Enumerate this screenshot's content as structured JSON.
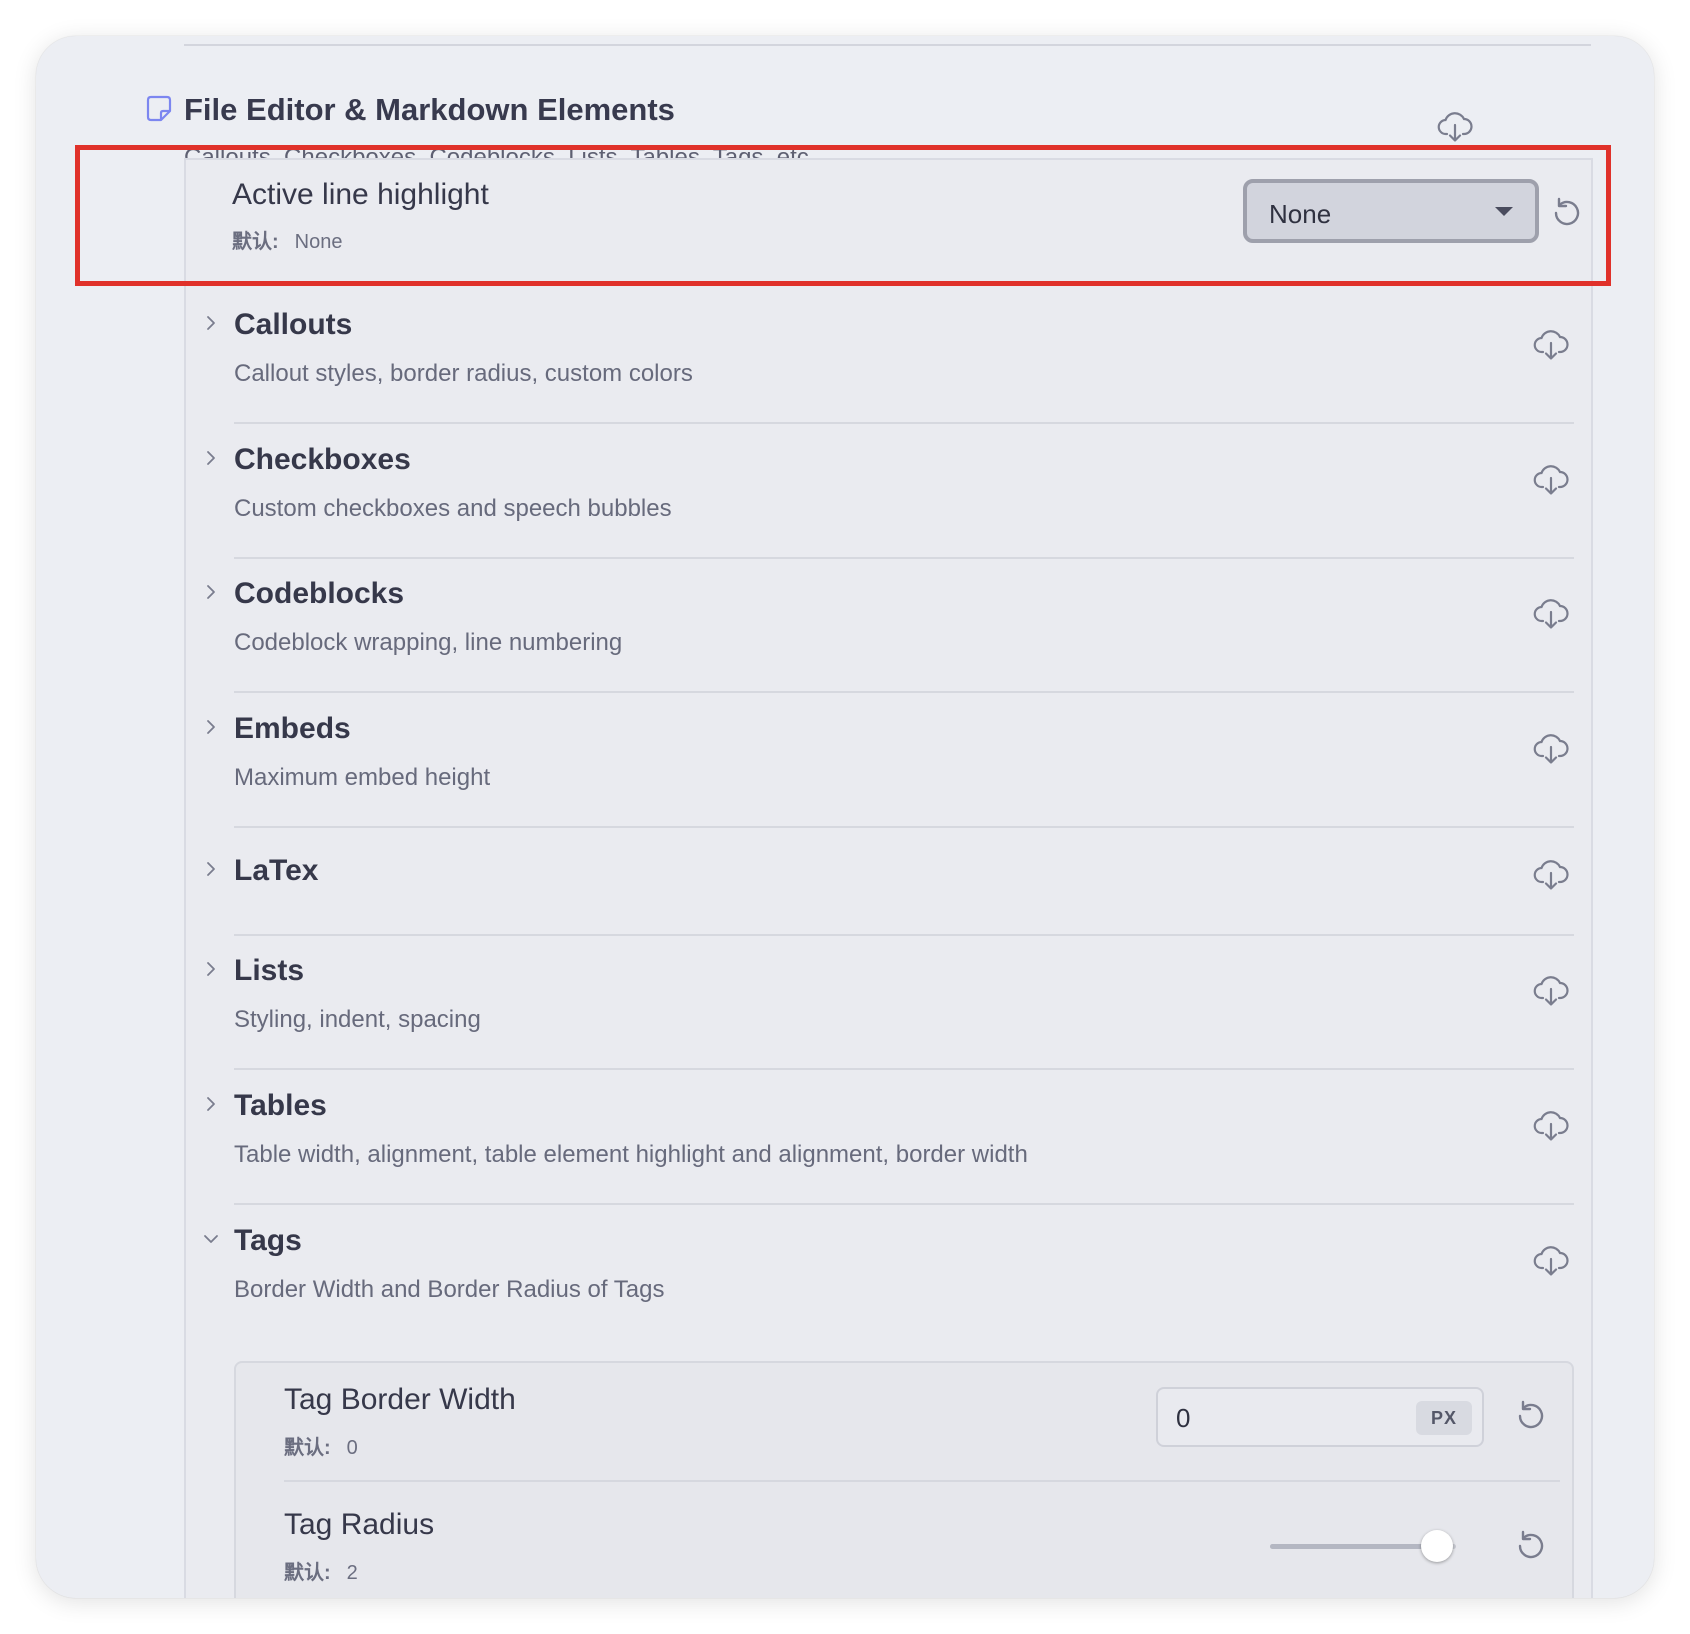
{
  "section": {
    "title": "File Editor & Markdown Elements",
    "description": "Callouts, Checkboxes, Codeblocks, Lists, Tables, Tags, etc."
  },
  "active_line": {
    "title": "Active line highlight",
    "default_label": "默认:",
    "default_value": "None",
    "selected": "None"
  },
  "groups": [
    {
      "title": "Callouts",
      "description": "Callout styles, border radius, custom colors",
      "expanded": false
    },
    {
      "title": "Checkboxes",
      "description": "Custom checkboxes and speech bubbles",
      "expanded": false
    },
    {
      "title": "Codeblocks",
      "description": "Codeblock wrapping, line numbering",
      "expanded": false
    },
    {
      "title": "Embeds",
      "description": "Maximum embed height",
      "expanded": false
    },
    {
      "title": "LaTex",
      "description": "",
      "expanded": false
    },
    {
      "title": "Lists",
      "description": "Styling, indent, spacing",
      "expanded": false
    },
    {
      "title": "Tables",
      "description": "Table width, alignment, table element highlight and alignment, border width",
      "expanded": false
    },
    {
      "title": "Tags",
      "description": "Border Width and Border Radius of Tags",
      "expanded": true
    }
  ],
  "tags_settings": {
    "border_width": {
      "title": "Tag Border Width",
      "default_label": "默认:",
      "default_value": "0",
      "value": "0",
      "unit": "PX"
    },
    "radius": {
      "title": "Tag Radius",
      "default_label": "默认:",
      "default_value": "2",
      "slider_fraction": 0.9
    }
  },
  "icons": {
    "section": "note-icon",
    "download": "cloud-download-icon",
    "reset": "reset-icon",
    "chevron_right": "chevron-right-icon",
    "chevron_down": "chevron-down-icon",
    "select_caret": "caret-down-icon"
  },
  "colors": {
    "accent_icon": "#7c86f0",
    "highlight_border": "#e0312a",
    "window_bg": "#eceef3"
  }
}
